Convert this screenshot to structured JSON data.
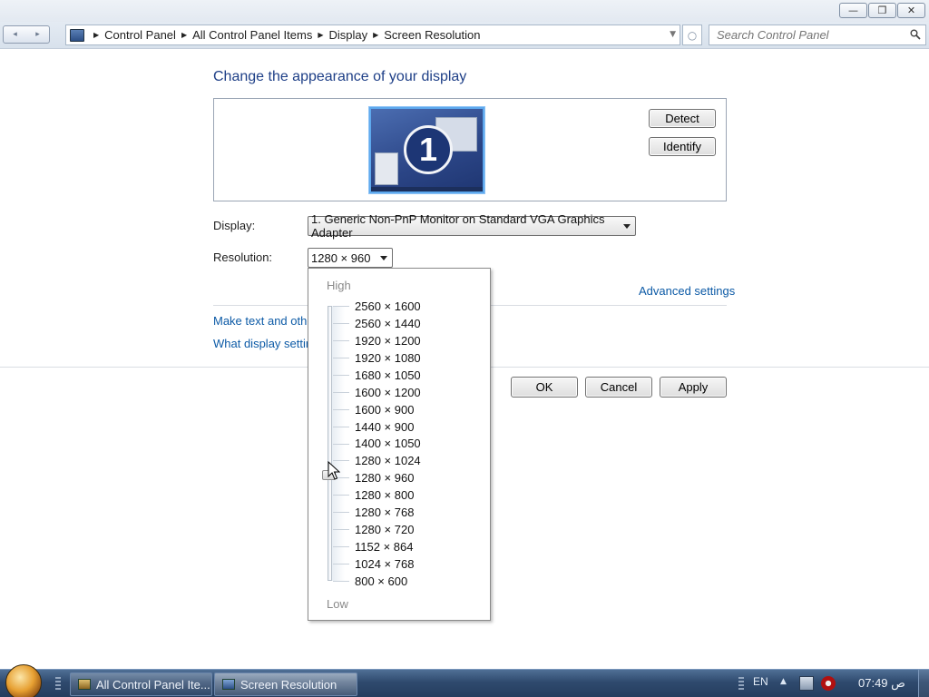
{
  "window": {
    "minimize_glyph": "—",
    "maximize_glyph": "❐",
    "close_glyph": "✕"
  },
  "address_bar": {
    "back_glyph": "◂",
    "forward_glyph": "▸",
    "breadcrumbs": [
      "Control Panel",
      "All Control Panel Items",
      "Display",
      "Screen Resolution"
    ],
    "search_placeholder": "Search Control Panel"
  },
  "main": {
    "title": "Change the appearance of your display",
    "monitor_number": "1",
    "detect_label": "Detect",
    "identify_label": "Identify",
    "display_label": "Display:",
    "display_value": "1. Generic Non-PnP Monitor on Standard VGA Graphics Adapter",
    "resolution_label": "Resolution:",
    "resolution_value": "1280 × 960",
    "advanced_link": "Advanced settings",
    "text_link": "Make text and other",
    "what_link": "What display setting",
    "ok_label": "OK",
    "cancel_label": "Cancel",
    "apply_label": "Apply"
  },
  "resolution_popup": {
    "high_label": "High",
    "low_label": "Low",
    "options": [
      "2560 × 1600",
      "2560 × 1440",
      "1920 × 1200",
      "1920 × 1080",
      "1680 × 1050",
      "1600 × 1200",
      "1600 × 900",
      "1440 × 900",
      "1400 × 1050",
      "1280 × 1024",
      "1280 × 960",
      "1280 × 800",
      "1280 × 768",
      "1280 × 720",
      "1152 × 864",
      "1024 × 768",
      "800 × 600"
    ],
    "selected_index": 10
  },
  "taskbar": {
    "tasks": [
      "All Control Panel Ite...",
      "Screen Resolution"
    ],
    "language": "EN",
    "tray_up_glyph": "▲",
    "clock": "07:49 ص"
  },
  "colors": {
    "accent": "#1e3f87",
    "link": "#0c5aa6",
    "taskbar": "#2f4a6e"
  }
}
